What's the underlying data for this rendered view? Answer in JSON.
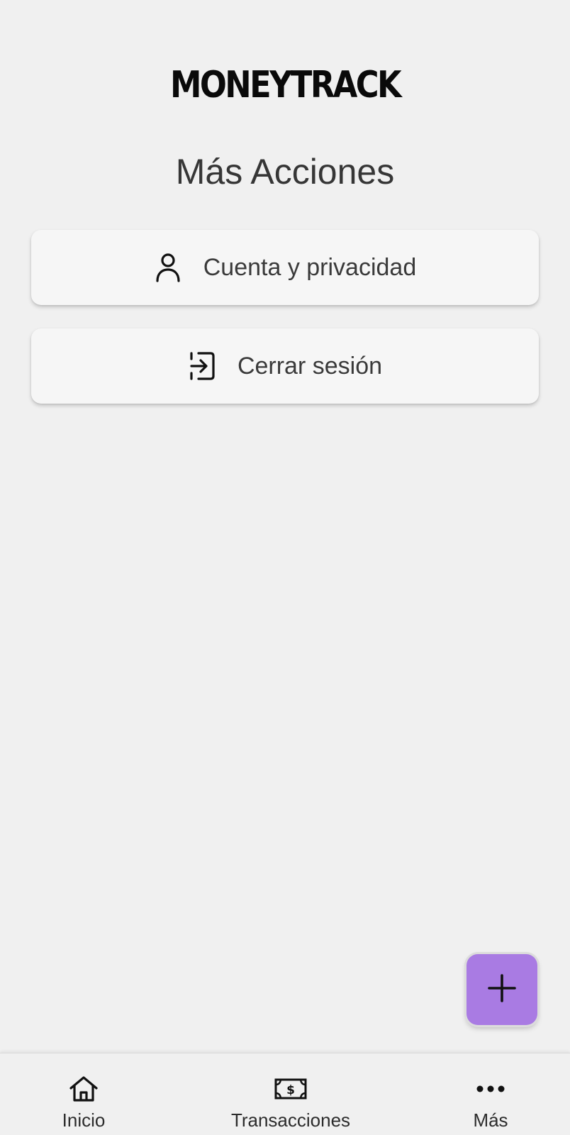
{
  "app": {
    "logo_text": "MONEYTRACK"
  },
  "page": {
    "title": "Más Acciones"
  },
  "actions": [
    {
      "label": "Cuenta y privacidad",
      "icon": "user-icon"
    },
    {
      "label": "Cerrar sesión",
      "icon": "logout-icon"
    }
  ],
  "fab": {
    "icon": "plus-icon",
    "color": "#a97be3"
  },
  "bottom_nav": {
    "items": [
      {
        "label": "Inicio",
        "icon": "home-icon"
      },
      {
        "label": "Transacciones",
        "icon": "banknote-icon"
      },
      {
        "label": "Más",
        "icon": "more-dots-icon"
      }
    ]
  },
  "colors": {
    "background": "#f0f0f0",
    "card": "#f6f6f6",
    "text": "#333333",
    "accent": "#a97be3"
  }
}
